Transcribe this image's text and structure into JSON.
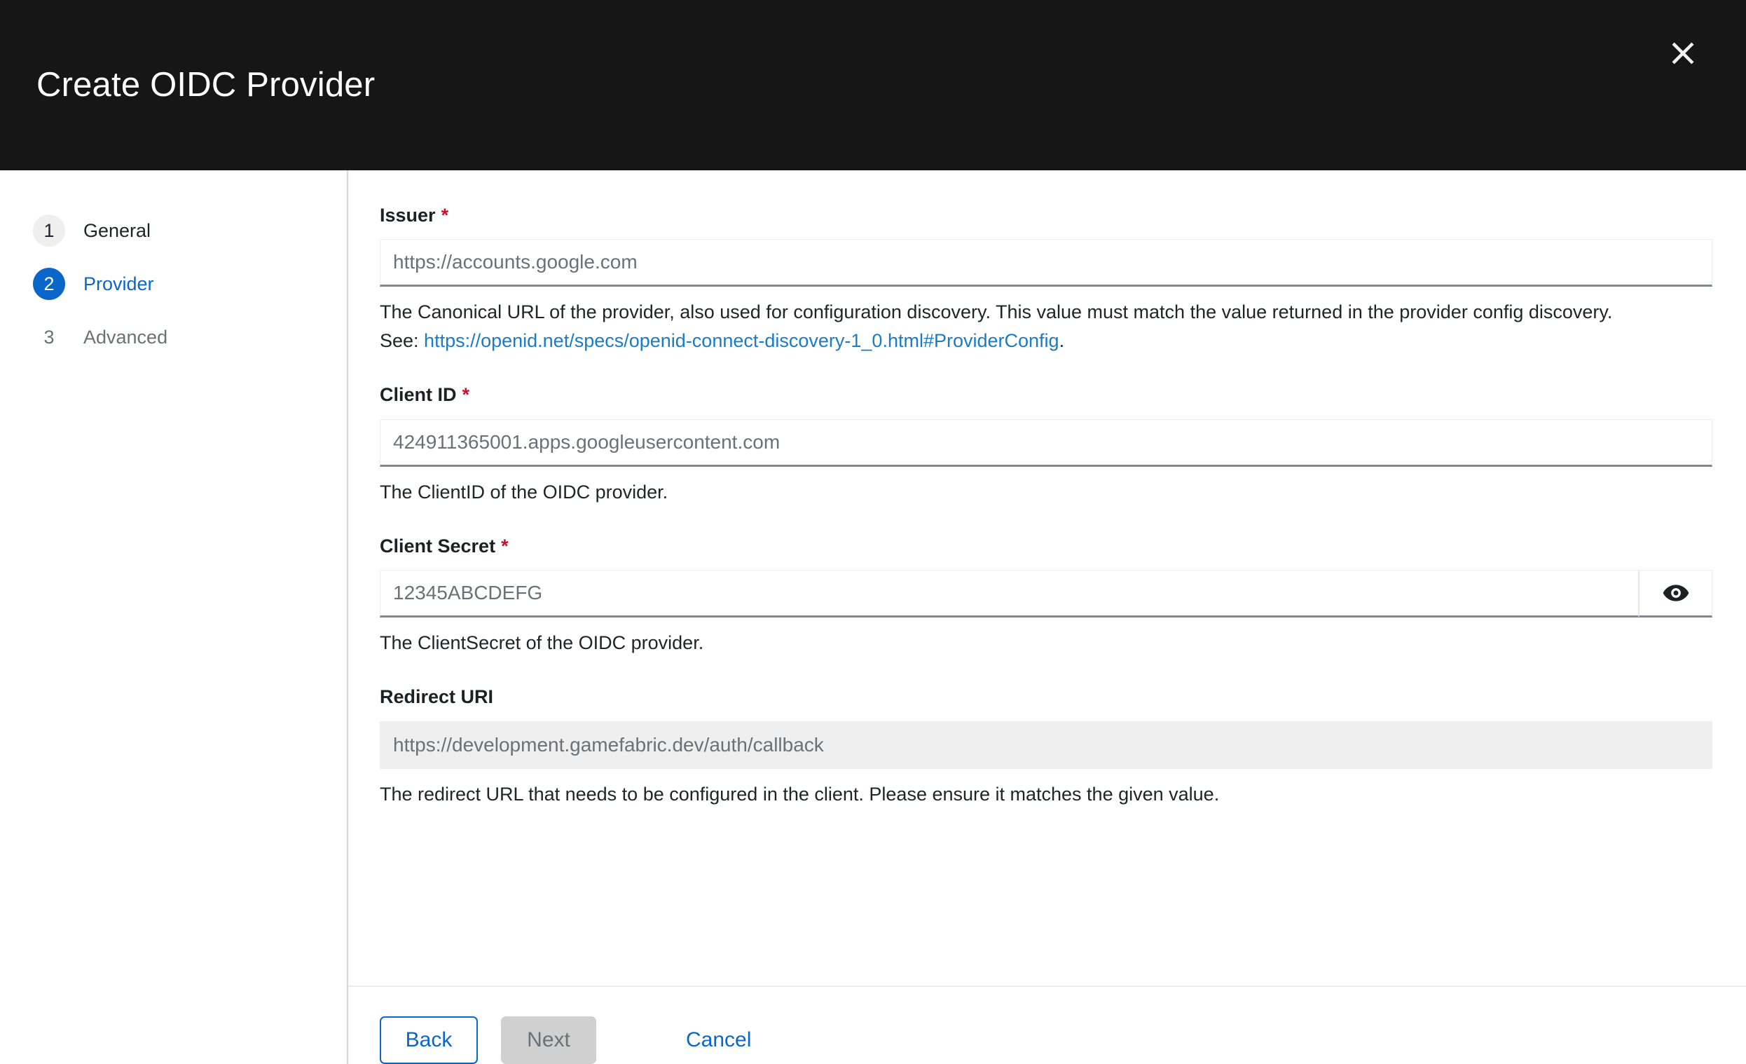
{
  "header": {
    "title": "Create OIDC Provider",
    "close_icon": "close-icon"
  },
  "steps": [
    {
      "number": "1",
      "label": "General",
      "state": "done"
    },
    {
      "number": "2",
      "label": "Provider",
      "state": "active"
    },
    {
      "number": "3",
      "label": "Advanced",
      "state": "todo"
    }
  ],
  "fields": {
    "issuer": {
      "label": "Issuer",
      "required_marker": "*",
      "value": "",
      "placeholder": "https://accounts.google.com",
      "help_line1": "The Canonical URL of the provider, also used for configuration discovery. This value must match the value returned in the provider config discovery.",
      "help_see_prefix": "See: ",
      "help_link_text": "https://openid.net/specs/openid-connect-discovery-1_0.html#ProviderConfig",
      "help_link_suffix": "."
    },
    "client_id": {
      "label": "Client ID",
      "required_marker": "*",
      "value": "",
      "placeholder": "424911365001.apps.googleusercontent.com",
      "help": "The ClientID of the OIDC provider."
    },
    "client_secret": {
      "label": "Client Secret",
      "required_marker": "*",
      "value": "",
      "placeholder": "12345ABCDEFG",
      "help": "The ClientSecret of the OIDC provider.",
      "reveal_icon": "eye-icon"
    },
    "redirect_uri": {
      "label": "Redirect URI",
      "value": "",
      "placeholder": "https://development.gamefabric.dev/auth/callback",
      "help": "The redirect URL that needs to be configured in the client. Please ensure it matches the given value."
    }
  },
  "footer": {
    "back_label": "Back",
    "next_label": "Next",
    "cancel_label": "Cancel"
  },
  "colors": {
    "header_bg": "#161616",
    "accent_blue": "#0a67c9",
    "link_blue": "#1a7bc9",
    "required_red": "#c8102e",
    "disabled_gray": "#d0d0d0",
    "field_bg_disabled": "#efefef"
  }
}
